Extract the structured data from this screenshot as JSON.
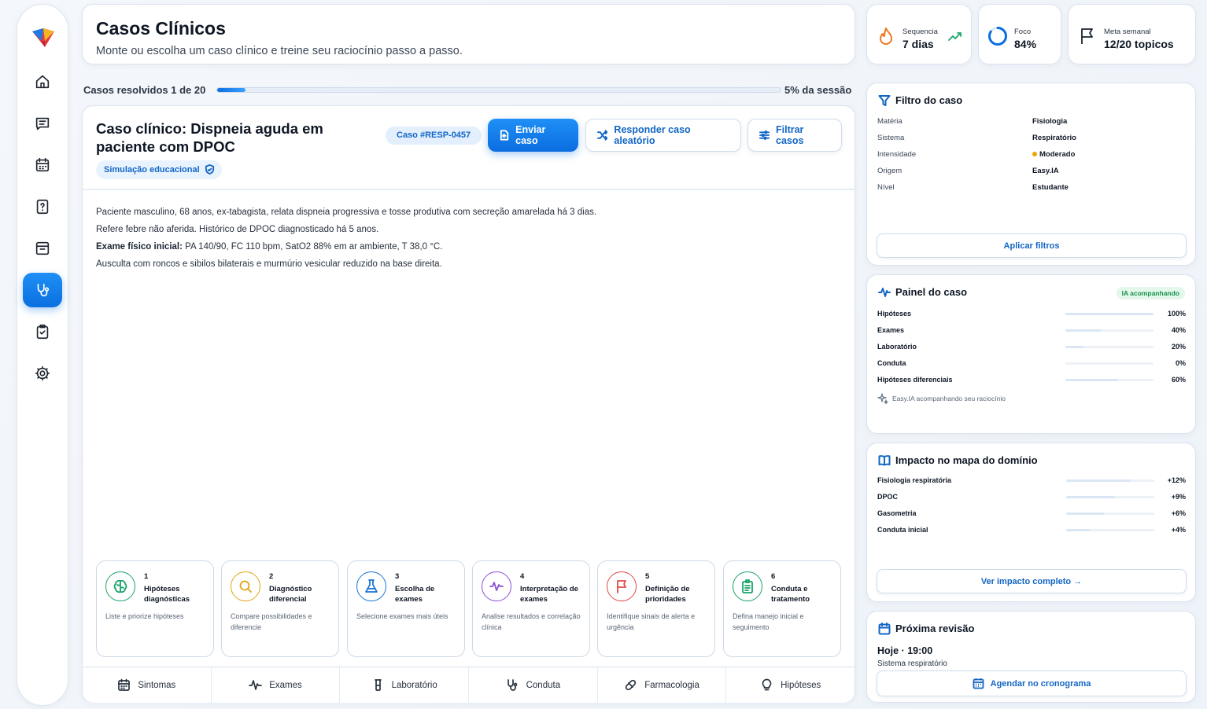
{
  "header": {
    "title": "Casos Clínicos",
    "subtitle": "Monte ou escolha um caso clínico e treine seu raciocínio passo a passo."
  },
  "stats": [
    {
      "label": "Sequencia",
      "value": "7 dias",
      "icon": "flame-icon"
    },
    {
      "label": "Foco",
      "value": "84%",
      "icon": "focus-ring-icon",
      "fraction": 0.84
    },
    {
      "label": "Meta semanal",
      "value": "12/20 topicos",
      "icon": "flag-icon"
    }
  ],
  "progress": {
    "label": "Casos resolvidos 1 de 20",
    "right": "5% da sessão",
    "fraction": 0.05
  },
  "case": {
    "title": "Caso clínico: Dispneia aguda em paciente com DPOC",
    "badge": "Simulação educacional",
    "id": "Caso #RESP-0457",
    "send_label": "Enviar caso",
    "random_label": "Responder caso aleatório",
    "filter_label": "Filtrar casos",
    "lines": [
      "Paciente masculino, 68 anos, ex-tabagista, relata dispneia progressiva e tosse produtiva com secreção amarelada há 3 dias.",
      "Refere febre não aferida. Histórico de DPOC diagnosticado há 5 anos."
    ],
    "exam_label": "Exame físico inicial:",
    "exam_text": " PA 140/90, FC 110 bpm, SatO2 88% em ar ambiente, T 38,0 °C.",
    "last_line": "Ausculta com roncos e sibilos bilaterais e murmúrio vesicular reduzido na base direita."
  },
  "steps": [
    {
      "num": "1",
      "title": "Hipóteses diagnósticas",
      "desc": "Liste e priorize hipóteses",
      "color": "#1aa36a"
    },
    {
      "num": "2",
      "title": "Diagnóstico diferencial",
      "desc": "Compare possibilidades e diferencie",
      "color": "#e0a514"
    },
    {
      "num": "3",
      "title": "Escolha de exames",
      "desc": "Selecione exames mais úteis",
      "color": "#1a74d6"
    },
    {
      "num": "4",
      "title": "Interpretação de exames",
      "desc": "Analise resultados e correlação clínica",
      "color": "#8a4fd8"
    },
    {
      "num": "5",
      "title": "Definição de prioridades",
      "desc": "Identifique sinais de alerta e urgência",
      "color": "#e04848"
    },
    {
      "num": "6",
      "title": "Conduta e tratamento",
      "desc": "Defina manejo inicial e seguimento",
      "color": "#1aa36a"
    }
  ],
  "tabs": [
    "Sintomas",
    "Exames",
    "Laboratório",
    "Conduta",
    "Farmacologia",
    "Hipóteses"
  ],
  "filter": {
    "title": "Filtro do caso",
    "rows": [
      {
        "k": "Matéria",
        "v": "Fisiologia"
      },
      {
        "k": "Sistema",
        "v": "Respiratório"
      },
      {
        "k": "Intensidade",
        "v": "Moderado"
      },
      {
        "k": "Origem",
        "v": "Easy.IA"
      },
      {
        "k": "Nível",
        "v": "Estudante"
      }
    ],
    "apply_label": "Aplicar filtros"
  },
  "panel": {
    "title": "Painel do caso",
    "badge": "IA acompanhando",
    "rows": [
      {
        "label": "Hipóteses",
        "pct": "100%",
        "value": 1.0
      },
      {
        "label": "Exames",
        "pct": "40%",
        "value": 0.4
      },
      {
        "label": "Laboratório",
        "pct": "20%",
        "value": 0.2
      },
      {
        "label": "Conduta",
        "pct": "0%",
        "value": 0.0
      },
      {
        "label": "Hipóteses diferenciais",
        "pct": "60%",
        "value": 0.6
      }
    ],
    "footer": "Easy.IA acompanhando seu raciocínio"
  },
  "impact": {
    "title": "Impacto no mapa do domínio",
    "rows": [
      {
        "label": "Fisiologia respiratória",
        "pct": "+12%",
        "value": 0.73
      },
      {
        "label": "DPOC",
        "pct": "+9%",
        "value": 0.55
      },
      {
        "label": "Gasometria",
        "pct": "+6%",
        "value": 0.43
      },
      {
        "label": "Conduta inicial",
        "pct": "+4%",
        "value": 0.27
      }
    ],
    "cta": "Ver impacto completo →"
  },
  "review": {
    "title": "Próxima revisão",
    "time": "Hoje · 19:00",
    "topic": "Sistema respiratório",
    "cta": "Agendar no cronograma"
  },
  "colors": {
    "accent": "#0b6fe0",
    "moderate": "#f0a500"
  }
}
